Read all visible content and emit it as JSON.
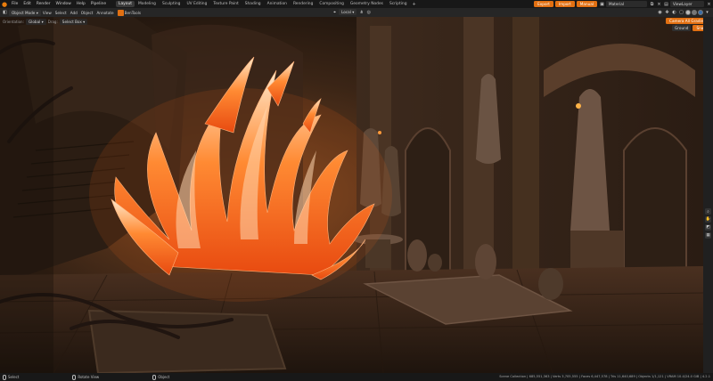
{
  "topbar": {
    "menus": [
      "File",
      "Edit",
      "Render",
      "Window",
      "Help",
      "Pipeline"
    ],
    "workspaces": [
      "Layout",
      "Modeling",
      "Sculpting",
      "UV Editing",
      "Texture Paint",
      "Shading",
      "Animation",
      "Rendering",
      "Compositing",
      "Geometry Nodes",
      "Scripting"
    ],
    "active_workspace": "Layout",
    "export_label": "Export",
    "import_label": "Import",
    "manual_label": "Manual",
    "scene_name": "Material",
    "view_layer": "ViewLayer"
  },
  "header": {
    "mode": "Object Mode",
    "menus": [
      "View",
      "Select",
      "Add",
      "Object",
      "Annotate"
    ],
    "tool_name": "BenTools",
    "orientation_label": "Orientation:",
    "orientation_value": "Global",
    "drag_label": "Drag:",
    "drag_value": "Select Box",
    "transform_space": "Local",
    "options_label": "Options",
    "camera_btn": "Camera All Grading",
    "ground_label": "Ground",
    "snap_label": "Snap"
  },
  "statusbar": {
    "left_action": "Select",
    "mid_action": "Rotate View",
    "right_action": "Object",
    "stats": "Scene Collection | 685,551,363 | Verts 3,705,555 | Faces 6,447,578 | Tris 11,640,689 | Objects 1/1,121 | VRAM 10.4/24.0 GiB | 4.2.1"
  },
  "colors": {
    "accent": "#e27012",
    "topbar_bg": "#181818",
    "header_bg": "#262626",
    "flame": "#ff6a1a"
  }
}
